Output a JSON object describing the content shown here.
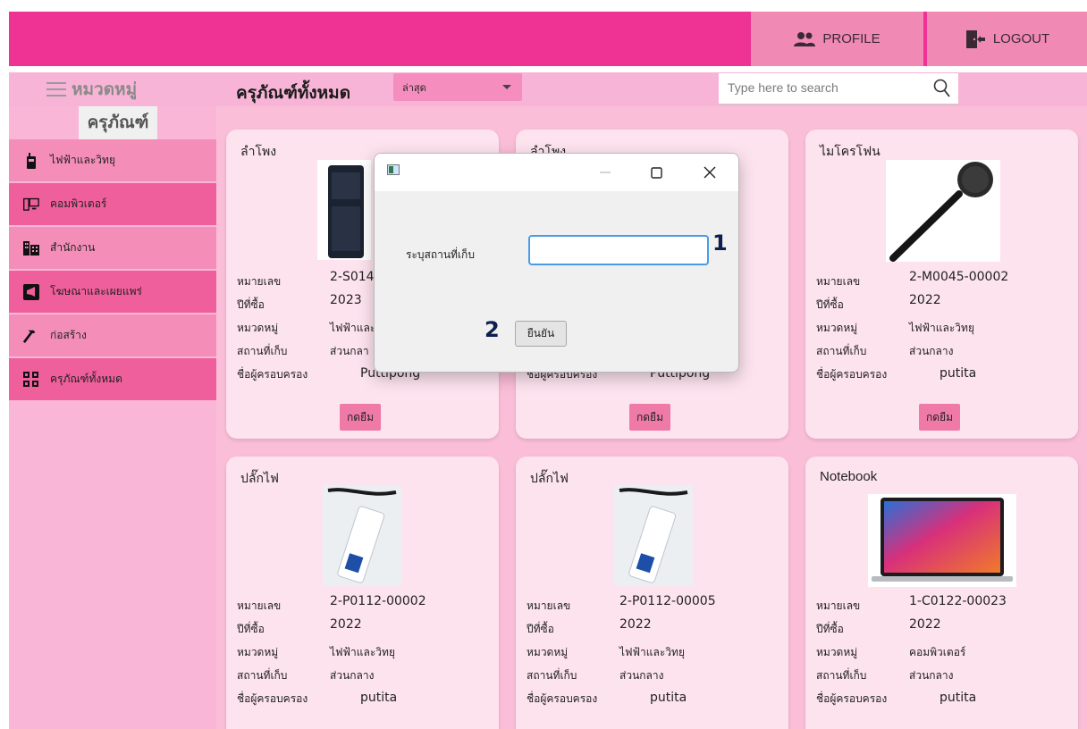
{
  "topbar": {
    "profile_label": "PROFILE",
    "logout_label": "LOGOUT",
    "profile_icon": "people-icon",
    "logout_icon": "logout-door-icon",
    "bg_color": "#ee3394"
  },
  "sidebar": {
    "header_label": "หมวดหมู่",
    "section_title": "ครุภัณฑ์",
    "items": [
      {
        "label": "ไฟฟ้าและวิทยุ",
        "icon": "walkie-talkie-icon"
      },
      {
        "label": "คอมพิวเตอร์",
        "icon": "computer-icon"
      },
      {
        "label": "สำนักงาน",
        "icon": "building-icon"
      },
      {
        "label": "โฆษณาและเผยแพร่",
        "icon": "megaphone-icon"
      },
      {
        "label": "ก่อสร้าง",
        "icon": "hammer-icon"
      },
      {
        "label": "ครุภัณฑ์ทั้งหมด",
        "icon": "grid-icon"
      }
    ]
  },
  "toolbar": {
    "page_title": "ครุภัณฑ์ทั้งหมด",
    "sort_value": "ล่าสุด",
    "search_placeholder": "Type here to search"
  },
  "labels": {
    "number": "หมายเลข",
    "year": "ปีที่ซื้อ",
    "category": "หมวดหมู่",
    "location": "สถานที่เก็บ",
    "owner": "ชื่อผู้ครอบครอง",
    "borrow": "กดยืม"
  },
  "cards": [
    {
      "title": "ลำโพง",
      "number": "2-S014",
      "year": "2023",
      "category": "ไฟฟ้าและ",
      "location": "ส่วนกลา",
      "owner": "Puttipong",
      "image": "speaker-image"
    },
    {
      "title": "ลำโพง",
      "number": "",
      "year": "",
      "category": "",
      "location": "",
      "owner": "Puttipong",
      "image": "speaker-image"
    },
    {
      "title": "ไมโครโฟน",
      "number": "2-M0045-00002",
      "year": "2022",
      "category": "ไฟฟ้าและวิทยุ",
      "location": "ส่วนกลาง",
      "owner": "putita",
      "image": "microphone-image"
    },
    {
      "title": "ปลั๊กไฟ",
      "number": "2-P0112-00002",
      "year": "2022",
      "category": "ไฟฟ้าและวิทยุ",
      "location": "ส่วนกลาง",
      "owner": "putita",
      "image": "power-strip-image"
    },
    {
      "title": "ปลั๊กไฟ",
      "number": "2-P0112-00005",
      "year": "2022",
      "category": "ไฟฟ้าและวิทยุ",
      "location": "ส่วนกลาง",
      "owner": "putita",
      "image": "power-strip-image"
    },
    {
      "title": "Notebook",
      "number": "1-C0122-00023",
      "year": "2022",
      "category": "คอมพิวเตอร์",
      "location": "ส่วนกลาง",
      "owner": "putita",
      "image": "laptop-image"
    }
  ],
  "dialog": {
    "field_label": "ระบุสถานที่เก็บ",
    "field_value": "",
    "confirm_label": "ยืนยัน",
    "marker_1": "1",
    "marker_2": "2"
  }
}
